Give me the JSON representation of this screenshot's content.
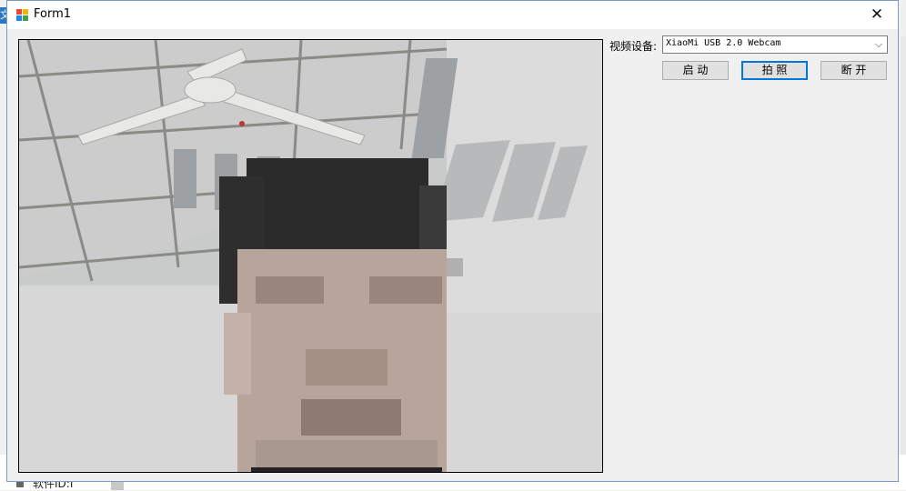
{
  "window": {
    "title": "Form1",
    "close_glyph": "✕"
  },
  "background": {
    "tab_text": "文",
    "footer_text": "软件ID:I"
  },
  "device": {
    "label": "视频设备:",
    "selected": "XiaoMi USB 2.0 Webcam",
    "dropdown_glyph": "⌵"
  },
  "buttons": {
    "start": "启 动",
    "capture": "拍 照",
    "disconnect": "断 开"
  },
  "icons": {
    "app": "winforms-app-icon",
    "close": "close-icon",
    "dropdown": "chevron-down-icon"
  },
  "colors": {
    "focus_border": "#0078d7",
    "window_border": "#7a9cc8",
    "button_face": "#e1e1e1"
  }
}
